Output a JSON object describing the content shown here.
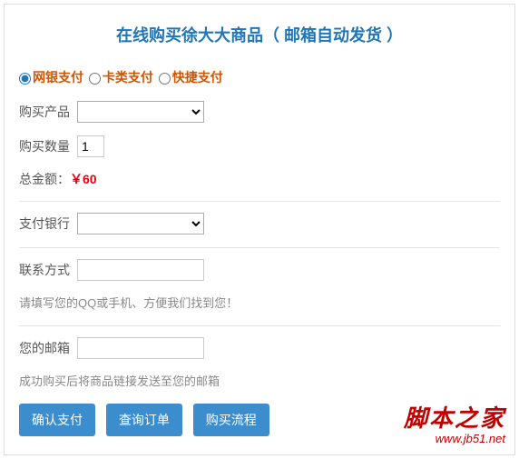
{
  "title": "在线购买徐大大商品（ 邮箱自动发货 ）",
  "payMethods": {
    "opt1": "网银支付",
    "opt2": "卡类支付",
    "opt3": "快捷支付"
  },
  "labels": {
    "product": "购买产品",
    "quantity": "购买数量",
    "totalLabel": "总金额：",
    "totalValue": "￥60",
    "bank": "支付银行",
    "contact": "联系方式",
    "contactHint": "请填写您的QQ或手机、方便我们找到您！",
    "email": "您的邮箱",
    "emailHint": "成功购买后将商品链接发送至您的邮箱"
  },
  "quantityValue": "1",
  "buttons": {
    "confirm": "确认支付",
    "query": "查询订单",
    "process": "购买流程"
  },
  "watermark": {
    "brand": "脚本之家",
    "url": "www.jb51.net"
  }
}
